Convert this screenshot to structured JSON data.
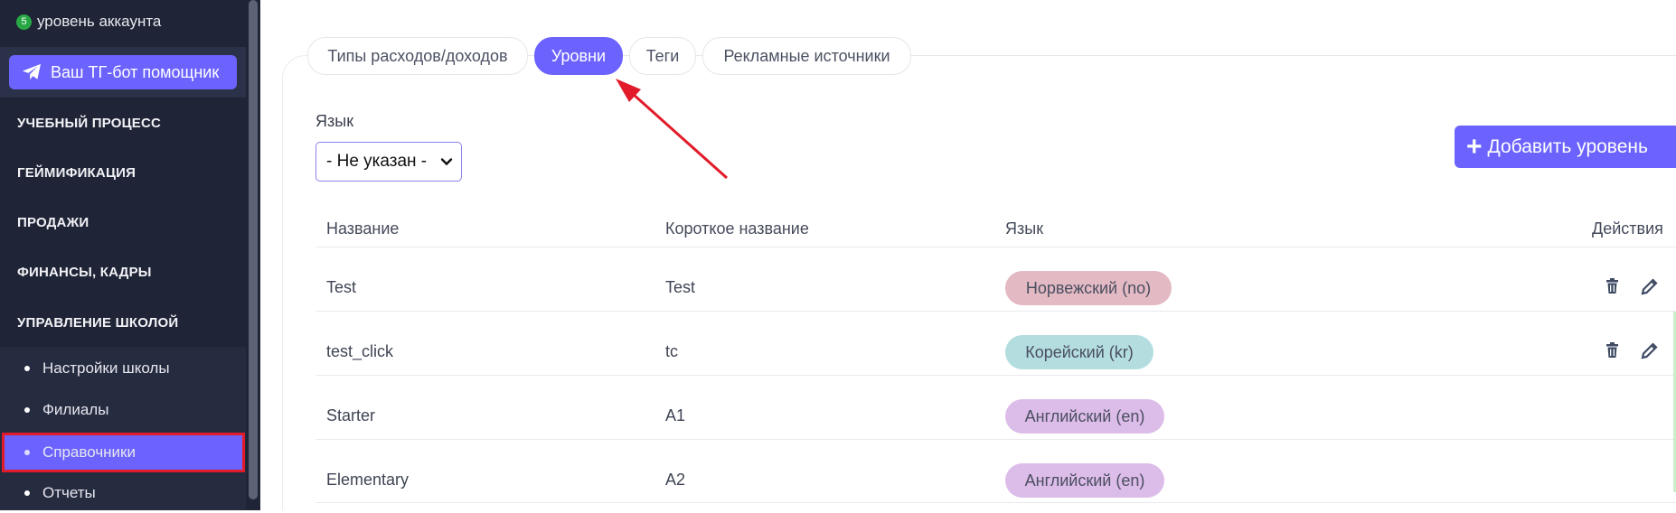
{
  "sidebar": {
    "account": {
      "level_badge": "5",
      "level_text": "уровень аккаунта"
    },
    "tg_button": {
      "label": "Ваш ТГ-бот помощник",
      "icon": "telegram-icon"
    },
    "sections": [
      {
        "label": "УЧЕБНЫЙ ПРОЦЕСС"
      },
      {
        "label": "ГЕЙМИФИКАЦИЯ"
      },
      {
        "label": "ПРОДАЖИ"
      },
      {
        "label": "ФИНАНСЫ, КАДРЫ"
      },
      {
        "label": "УПРАВЛЕНИЕ ШКОЛОЙ"
      }
    ],
    "sub_items": [
      {
        "label": "Настройки школы"
      },
      {
        "label": "Филиалы"
      },
      {
        "label": "Справочники",
        "active": true
      },
      {
        "label": "Отчеты"
      }
    ]
  },
  "tabs": [
    {
      "label": "Типы расходов/доходов"
    },
    {
      "label": "Уровни",
      "active": true
    },
    {
      "label": "Теги"
    },
    {
      "label": "Рекламные источники"
    }
  ],
  "filter": {
    "language_label": "Язык",
    "language_value": "- Не указан -"
  },
  "add_button": {
    "label": "Добавить уровень",
    "icon": "plus-icon"
  },
  "table": {
    "headers": [
      "Название",
      "Короткое название",
      "Язык",
      "Действия"
    ],
    "rows": [
      {
        "name": "Test",
        "short": "Test",
        "language": "Норвежский (no)",
        "actions": true
      },
      {
        "name": "test_click",
        "short": "tc",
        "language": "Корейский (kr)",
        "actions": true
      },
      {
        "name": "Starter",
        "short": "A1",
        "language": "Английский (en)",
        "actions": false
      },
      {
        "name": "Elementary",
        "short": "A2",
        "language": "Английский (en)",
        "actions": false
      }
    ]
  },
  "colors": {
    "accent": "#6c63ff",
    "sidebar_bg": "#1f2537",
    "pill_norwegian": "#e3b9c3",
    "pill_korean": "#b4dde0",
    "pill_english": "#dcbce8",
    "annotation_red": "#e21b2a"
  }
}
